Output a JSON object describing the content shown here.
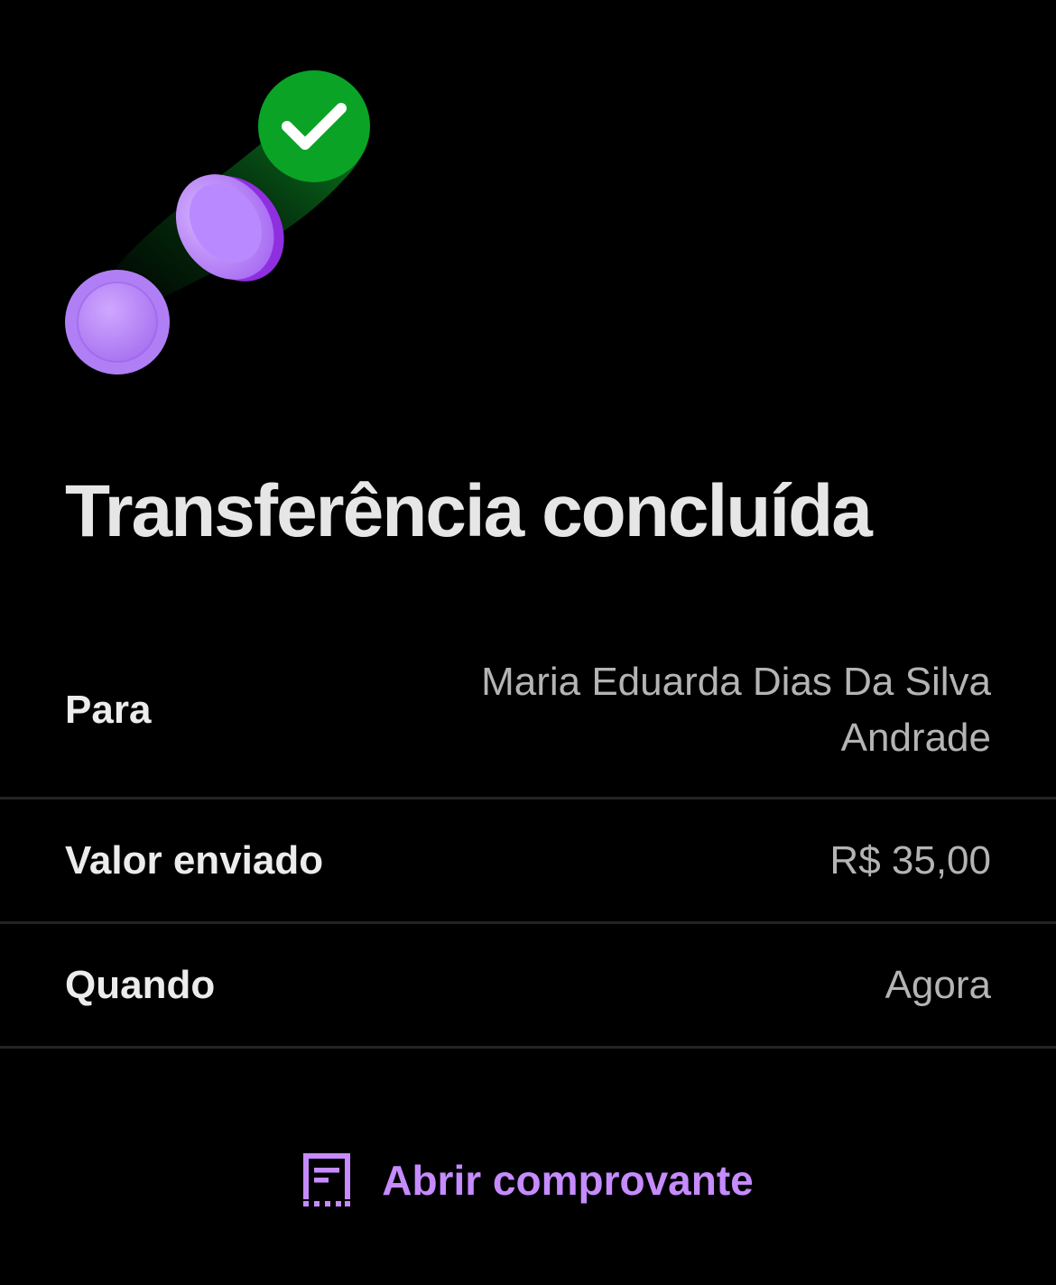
{
  "screen": {
    "title": "Transferência concluída",
    "hero_icon": "coins-transfer-success-icon"
  },
  "details": [
    {
      "label": "Para",
      "value": "Maria Eduarda Dias Da Silva Andrade"
    },
    {
      "label": "Valor enviado",
      "value": "R$ 35,00"
    },
    {
      "label": "Quando",
      "value": "Agora"
    }
  ],
  "actions": {
    "open_receipt_label": "Abrir comprovante",
    "open_receipt_icon": "receipt-icon"
  },
  "colors": {
    "background": "#000000",
    "success_green": "#0aa326",
    "coin_purple": "#b57cff",
    "accent_purple": "#c58bff",
    "divider": "#232323"
  }
}
